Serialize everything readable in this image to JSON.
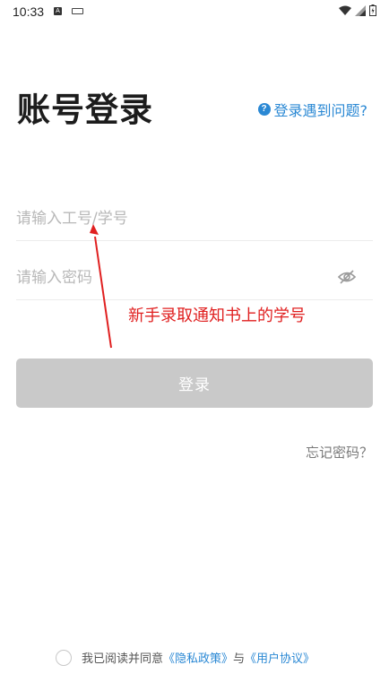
{
  "status_bar": {
    "time": "10:33",
    "icons": [
      "android-a-icon",
      "keyboard-icon",
      "wifi-icon",
      "signal-icon",
      "battery-icon"
    ]
  },
  "header": {
    "title": "账号登录",
    "help_label": "登录遇到问题?"
  },
  "form": {
    "username": {
      "placeholder": "请输入工号/学号",
      "value": ""
    },
    "password": {
      "placeholder": "请输入密码",
      "value": ""
    },
    "login_label": "登录",
    "forgot_label": "忘记密码？"
  },
  "annotation": {
    "text": "新手录取通知书上的学号"
  },
  "agreement": {
    "prefix": "我已阅读并同意",
    "privacy_link": "《隐私政策》",
    "conjunction": "与",
    "terms_link": "《用户协议》",
    "checked": false
  },
  "colors": {
    "accent": "#2a88d4",
    "button_disabled": "#c9c9c9",
    "annotation": "#e02020"
  }
}
